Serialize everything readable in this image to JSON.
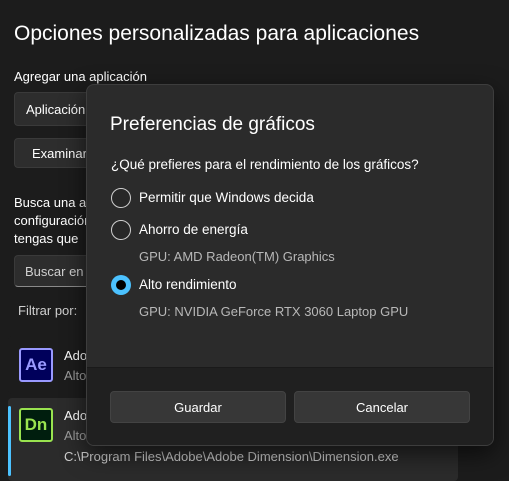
{
  "background": {
    "title": "Opciones personalizadas para aplicaciones",
    "add_app_label": "Agregar una aplicación",
    "app_type_select": "Aplicación de escritorio",
    "browse_button": "Examinar",
    "description_lines": [
      "Busca una aplicación",
      "configuración",
      "tengas que"
    ],
    "search_placeholder": "Buscar en esta lista",
    "filter_label": "Filtrar por:",
    "apps": [
      {
        "name": "Adobe After Effects",
        "pref": "Alto rendimiento",
        "icon_text": "Ae"
      },
      {
        "name": "Adobe Dimension",
        "pref": "Alto rendimiento",
        "path": "C:\\Program Files\\Adobe\\Adobe Dimension\\Dimension.exe",
        "icon_text": "Dn"
      }
    ]
  },
  "dialog": {
    "title": "Preferencias de gráficos",
    "question": "¿Qué prefieres para el rendimiento de los gráficos?",
    "options": [
      {
        "label": "Permitir que Windows decida",
        "selected": false
      },
      {
        "label": "Ahorro de energía",
        "gpu": "GPU: AMD Radeon(TM) Graphics",
        "selected": false
      },
      {
        "label": "Alto rendimiento",
        "gpu": "GPU: NVIDIA GeForce RTX 3060 Laptop GPU",
        "selected": true
      }
    ],
    "save_label": "Guardar",
    "cancel_label": "Cancelar"
  },
  "colors": {
    "accent": "#4cc2ff",
    "background": "#1c1c1c",
    "dialog_background": "#2b2b2b",
    "footer_background": "#202020"
  }
}
